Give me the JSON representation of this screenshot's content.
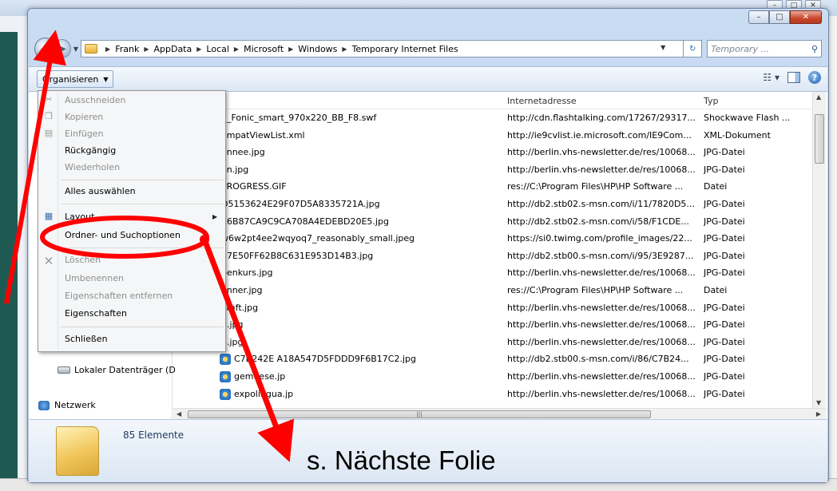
{
  "window": {
    "controls": {
      "minimize": "–",
      "maximize": "□",
      "close": "✕"
    }
  },
  "address_bar": {
    "breadcrumbs": [
      "Frank",
      "AppData",
      "Local",
      "Microsoft",
      "Windows",
      "Temporary Internet Files"
    ],
    "search_placeholder": "Temporary ..."
  },
  "toolbar": {
    "organize_label": "Organisieren"
  },
  "context_menu": {
    "items": [
      {
        "label": "Ausschneiden",
        "enabled": false,
        "icon": "scissors-icon"
      },
      {
        "label": "Kopieren",
        "enabled": false,
        "icon": "copy-icon"
      },
      {
        "label": "Einfügen",
        "enabled": false,
        "icon": "paste-icon"
      },
      {
        "label": "Rückgängig",
        "enabled": true
      },
      {
        "label": "Wiederholen",
        "enabled": false
      },
      {
        "label": "Alles auswählen",
        "enabled": true
      },
      {
        "label": "Layout",
        "enabled": true,
        "submenu": true,
        "icon": "layout-icon"
      },
      {
        "label": "Ordner- und Suchoptionen",
        "enabled": true
      },
      {
        "label": "Löschen",
        "enabled": false,
        "icon": "delete-icon"
      },
      {
        "label": "Umbenennen",
        "enabled": false
      },
      {
        "label": "Eigenschaften entfernen",
        "enabled": false
      },
      {
        "label": "Eigenschaften",
        "enabled": true
      },
      {
        "label": "Schließen",
        "enabled": true
      }
    ]
  },
  "nav_pane": {
    "drive_label": "Lokaler Datenträger (D",
    "network_label": "Netzwerk"
  },
  "file_list": {
    "columns": {
      "url": "Internetadresse",
      "type": "Typ"
    },
    "rows": [
      {
        "name": "7_Fonic_smart_970x220_BB_F8.swf",
        "url": "http://cdn.flashtalking.com/17267/29317...",
        "type": "Shockwave Flash ..."
      },
      {
        "name": "ompatViewList.xml",
        "url": "http://ie9cvlist.ie.microsoft.com/IE9Com...",
        "type": "XML-Dokument"
      },
      {
        "name": "annee.jpg",
        "url": "http://berlin.vhs-newsletter.de/res/10068...",
        "type": "JPG-Datei"
      },
      {
        "name": "en.jpg",
        "url": "http://berlin.vhs-newsletter.de/res/10068...",
        "type": "JPG-Datei"
      },
      {
        "name": "PROGRESS.GIF",
        "url": "res://C:\\Program Files\\HP\\HP Software ...",
        "type": "Datei"
      },
      {
        "name": "D5153624E29F07D5A8335721A.jpg",
        "url": "http://db2.stb02.s-msn.com/i/11/7820D5...",
        "type": "JPG-Datei"
      },
      {
        "name": "E6B87CA9C9CA708A4EDEBD20E5.jpg",
        "url": "http://db2.stb02.s-msn.com/i/58/F1CDE...",
        "type": "JPG-Datei"
      },
      {
        "name": "w6w2pt4ee2wqyoq7_reasonably_small.jpeg",
        "url": "https://si0.twimg.com/profile_images/22...",
        "type": "JPG-Datei"
      },
      {
        "name": "37E50FF62B8C631E953D14B3.jpg",
        "url": "http://db2.stb00.s-msn.com/i/95/3E9287...",
        "type": "JPG-Datei"
      },
      {
        "name": "benkurs.jpg",
        "url": "http://berlin.vhs-newsletter.de/res/10068...",
        "type": "JPG-Datei"
      },
      {
        "name": "anner.jpg",
        "url": "res://C:\\Program Files\\HP\\HP Software ...",
        "type": "Datei"
      },
      {
        "name": "kraft.jpg",
        "url": "http://berlin.vhs-newsletter.de/res/10068...",
        "type": "JPG-Datei"
      },
      {
        "name": "n.jpg",
        "url": "http://berlin.vhs-newsletter.de/res/10068...",
        "type": "JPG-Datei"
      },
      {
        "name": "n.jpg",
        "url": "http://berlin.vhs-newsletter.de/res/10068...",
        "type": "JPG-Datei"
      },
      {
        "name": "C7B242E A18A547D5FDDD9F6B17C2.jpg",
        "url": "http://db2.stb00.s-msn.com/i/86/C7B24...",
        "type": "JPG-Datei"
      },
      {
        "name": "gemuese.jp",
        "url": "http://berlin.vhs-newsletter.de/res/10068...",
        "type": "JPG-Datei"
      },
      {
        "name": "expolingua.jp",
        "url": "http://berlin.vhs-newsletter.de/res/10068...",
        "type": "JPG-Datei"
      }
    ]
  },
  "details_pane": {
    "item_count": "85 Elemente"
  },
  "annotation": {
    "text": "s. Nächste Folie",
    "color": "#ff0000"
  }
}
